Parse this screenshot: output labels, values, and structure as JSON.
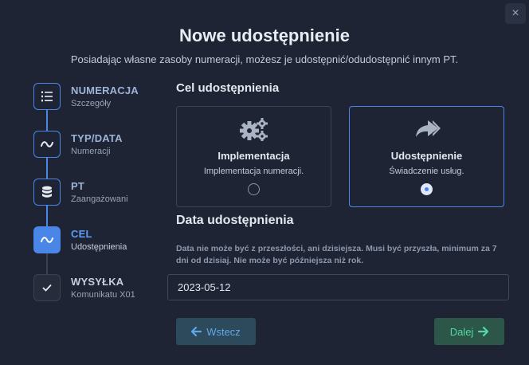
{
  "dialog": {
    "title": "Nowe udostępnienie",
    "subtitle": "Posiadając własne zasoby numeracji, możesz je udostępnić/odudostępnić innym PT.",
    "close_icon": "×"
  },
  "stepper": {
    "steps": [
      {
        "title": "NUMERACJA",
        "subtitle": "Szczegóły",
        "icon": "list-ordered-icon",
        "state": "done"
      },
      {
        "title": "TYP/DATA",
        "subtitle": "Numeracji",
        "icon": "tilde-icon",
        "state": "done"
      },
      {
        "title": "PT",
        "subtitle": "Zaangażowani",
        "icon": "database-icon",
        "state": "done"
      },
      {
        "title": "CEL",
        "subtitle": "Udostępnienia",
        "icon": "tilde-icon",
        "state": "active"
      },
      {
        "title": "WYSYŁKA",
        "subtitle": "Komunikatu X01",
        "icon": "check-icon",
        "state": "pending"
      }
    ]
  },
  "purpose": {
    "heading": "Cel udostępnienia",
    "options": [
      {
        "title": "Implementacja",
        "description": "Implementacja numeracji.",
        "icon": "gears-icon",
        "selected": false
      },
      {
        "title": "Udostępnienie",
        "description": "Świadczenie usług.",
        "icon": "share-icon",
        "selected": true
      }
    ]
  },
  "date": {
    "heading": "Data udostępnienia",
    "hint": "Data nie może być z przeszłości, ani dzisiejsza. Musi być przyszła, minimum za 7 dni od dzisiaj. Nie może być późniejsza niż rok.",
    "value": "2023-05-12"
  },
  "actions": {
    "back_label": "Wstecz",
    "next_label": "Dalej"
  },
  "colors": {
    "background": "#1e2433",
    "accent": "#4a86e8",
    "back_button": "#2c4a5c",
    "next_button": "#2b5648"
  }
}
